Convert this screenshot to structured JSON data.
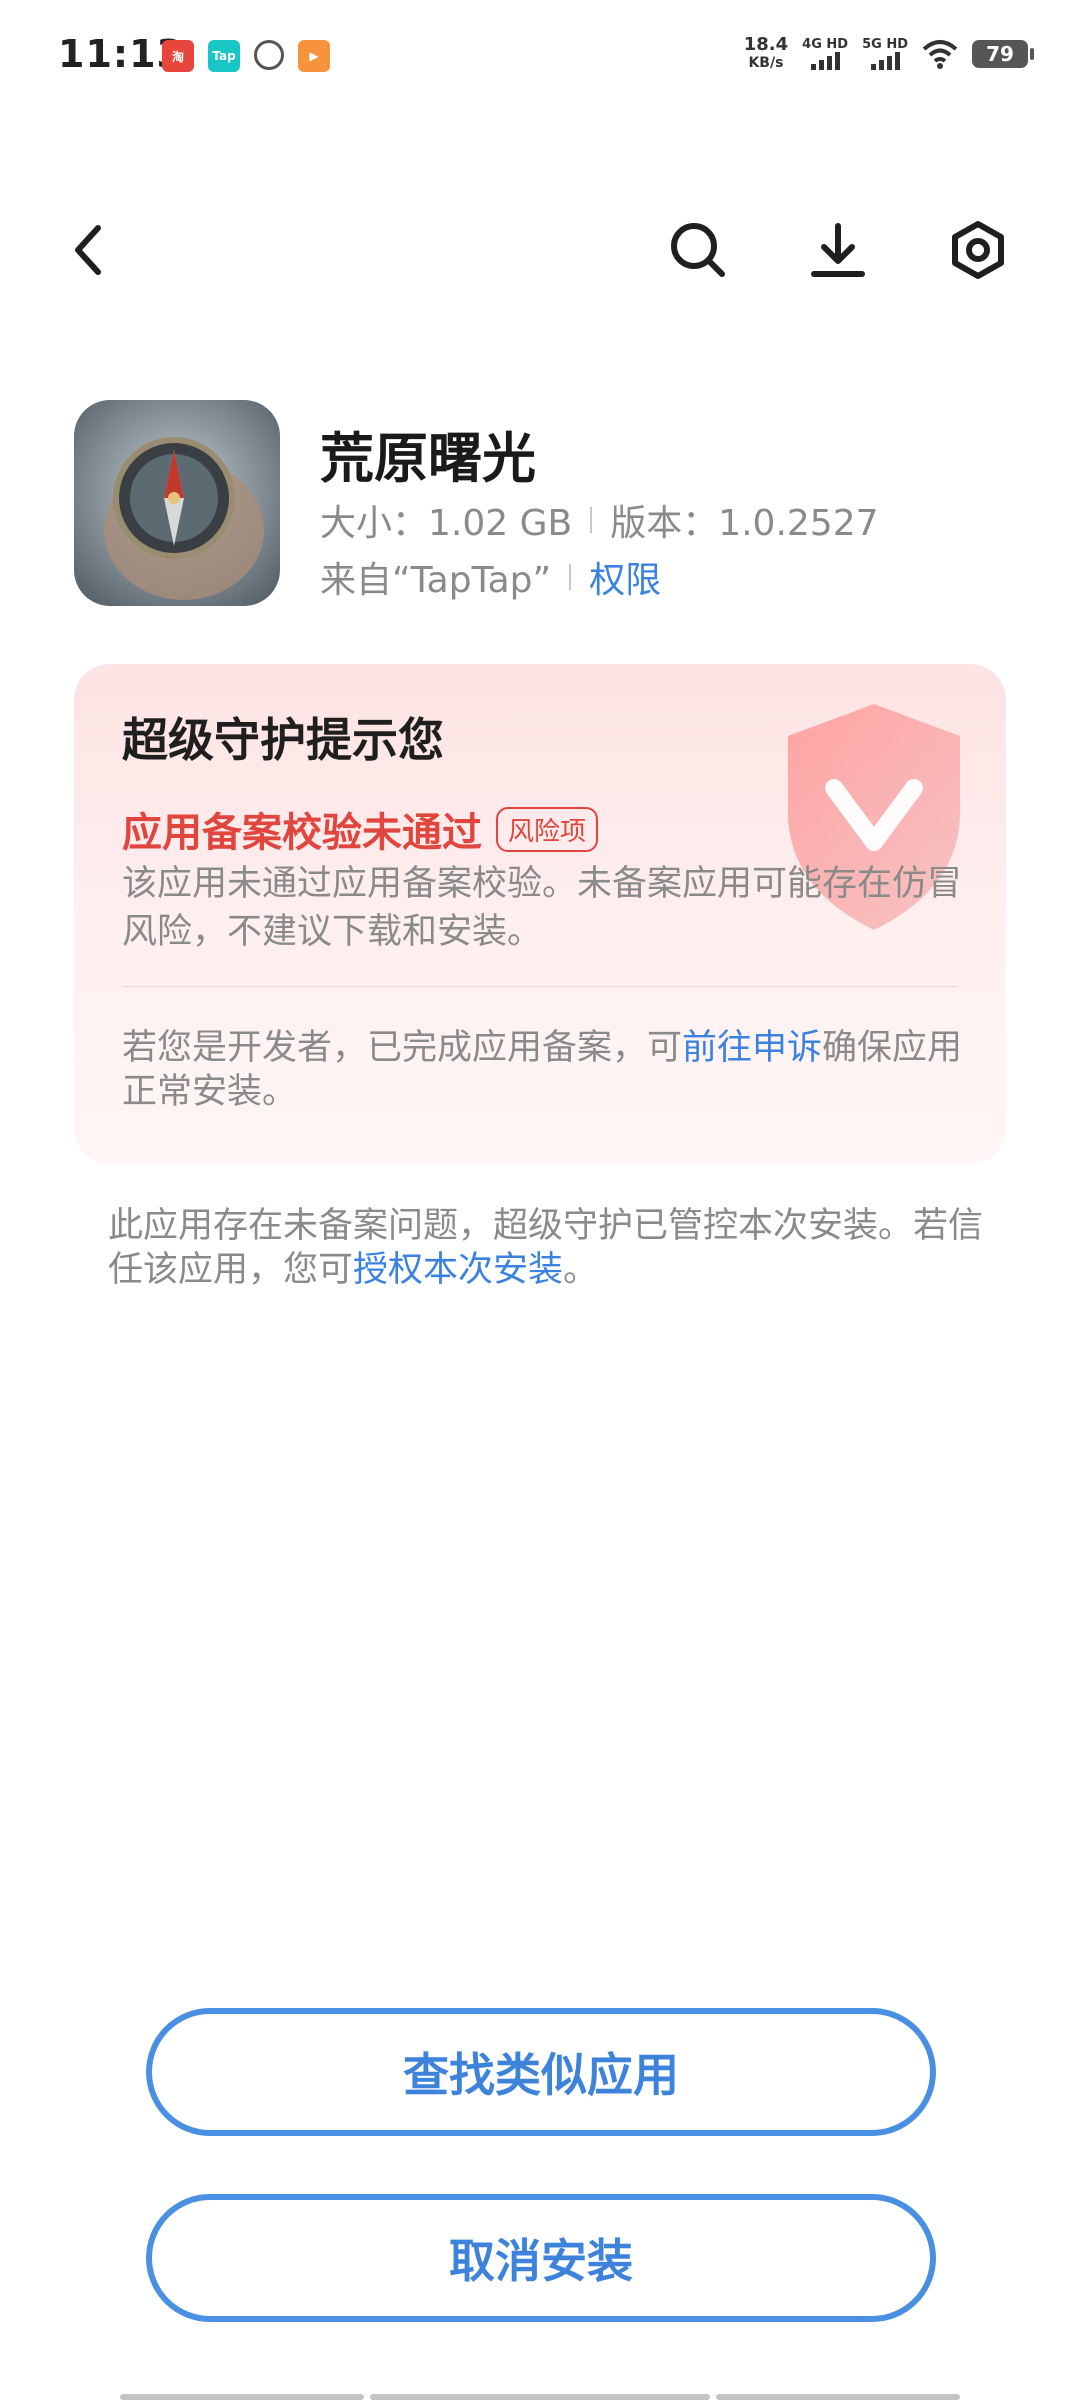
{
  "status_bar": {
    "time": "11:13",
    "speed_value": "18.4",
    "speed_unit": "KB/s",
    "net1": "4G HD",
    "net2": "5G HD",
    "battery": "79",
    "app_icons": [
      "taobao-icon",
      "tap-icon",
      "link-icon",
      "video-icon"
    ]
  },
  "nav": {
    "icons": [
      "back-icon",
      "search-icon",
      "download-icon",
      "settings-icon"
    ]
  },
  "app": {
    "name": "荒原曙光",
    "size_label": "大小：1.02 GB",
    "version_label": "版本：1.0.2527",
    "source_label": "来自“TapTap”",
    "permissions_link": "权限"
  },
  "guard_card": {
    "title": "超级守护提示您",
    "warning_title": "应用备案校验未通过",
    "risk_badge": "风险项",
    "warning_desc": "该应用未通过应用备案校验。未备案应用可能存在仿冒风险，不建议下载和安装。",
    "dev_note_prefix": "若您是开发者，已完成应用备案，可",
    "dev_note_link": "前往申诉",
    "dev_note_suffix": "确保应用正常安装。"
  },
  "notice": {
    "prefix": "此应用存在未备案问题，超级守护已管控本次安装。若信任该应用，您可",
    "link": "授权本次安装",
    "suffix": "。"
  },
  "buttons": {
    "find_similar": "查找类似应用",
    "cancel_install": "取消安装"
  },
  "colors": {
    "accent": "#3d83db",
    "danger": "#e0463e",
    "muted_text": "#8a8a8a",
    "card_bg": "#fde3e3"
  }
}
